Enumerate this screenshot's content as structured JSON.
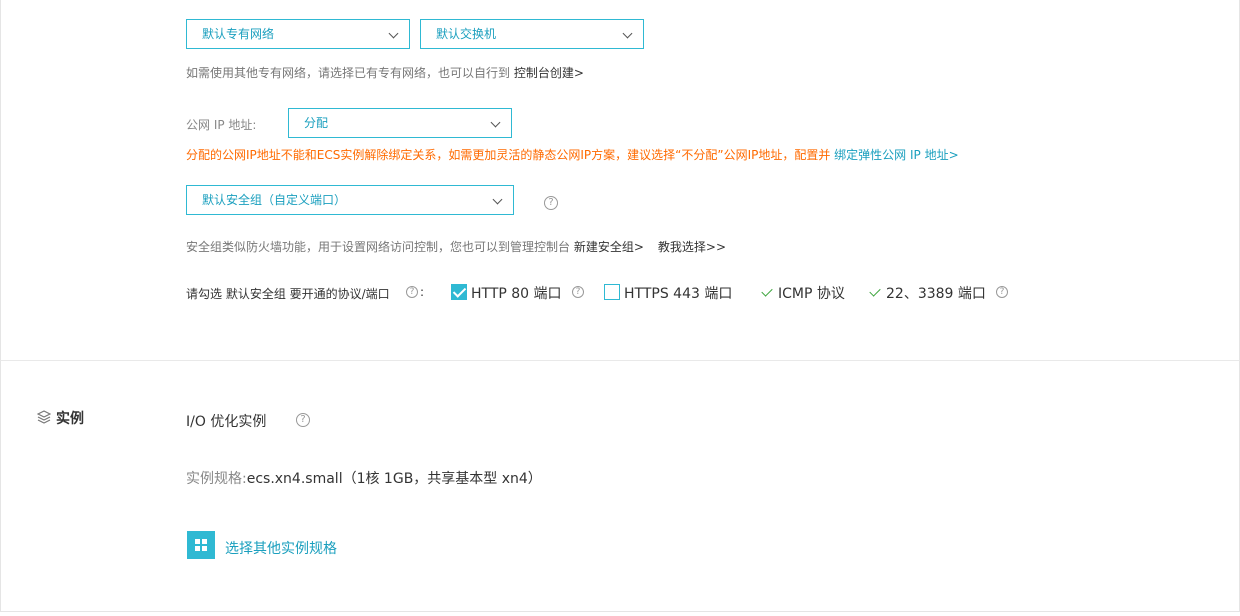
{
  "network": {
    "vpc_select": "默认专有网络",
    "vswitch_select": "默认交换机",
    "hint_text": "如需使用其他专有网络，请选择已有专有网络，也可以自行到 ",
    "hint_link": "控制台创建>"
  },
  "public_ip": {
    "label": "公网 IP 地址:",
    "select_value": "分配",
    "warning_text": "分配的公网IP地址不能和ECS实例解除绑定关系，如需更加灵活的静态公网IP方案，建议选择“不分配”公网IP地址，配置并 ",
    "warning_link": "绑定弹性公网 IP 地址>"
  },
  "security_group": {
    "select_value": "默认安全组（自定义端口）",
    "help_icon": "question-circle-icon",
    "hint_text": "安全组类似防火墙功能，用于设置网络访问控制，您也可以到管理控制台 ",
    "hint_link_create": "新建安全组>",
    "hint_link_guide": "教我选择>>"
  },
  "protocols": {
    "label": "请勾选 默认安全组 要开通的协议/端口",
    "label_colon": ":",
    "items": [
      {
        "label": "HTTP 80 端口",
        "checked": true
      },
      {
        "label": "HTTPS 443 端口",
        "checked": false
      },
      {
        "label": "ICMP 协议",
        "fixed": true
      },
      {
        "label": "22、3389 端口",
        "fixed": true
      }
    ]
  },
  "instance": {
    "section_title": "实例",
    "section_icon": "layers-icon",
    "io_label": "I/O 优化实例",
    "spec_label": "实例规格:",
    "spec_value": "ecs.xn4.small（1核 1GB，共享基本型 xn4）",
    "other_spec_link": "选择其他实例规格",
    "other_spec_icon": "grid-icon"
  },
  "colors": {
    "accent": "#2fb9d3",
    "link": "#1a9fbe",
    "warning": "#ff6a00",
    "check_green": "#3aa33a"
  }
}
